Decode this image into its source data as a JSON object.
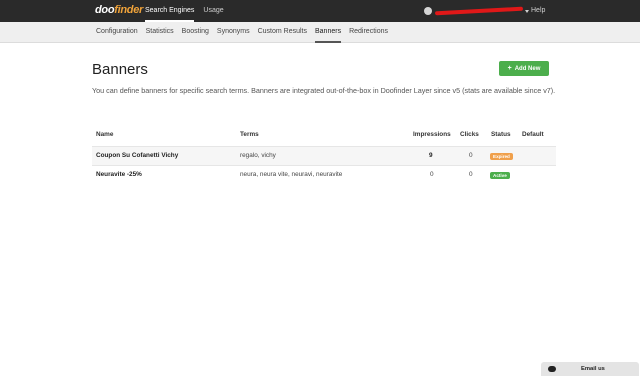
{
  "topbar": {
    "logo_main": "doo",
    "logo_accent": "finder",
    "nav": [
      {
        "label": "Search Engines",
        "active": true
      },
      {
        "label": "Usage",
        "active": false
      }
    ],
    "help": "Help"
  },
  "subnav": {
    "tabs": [
      {
        "label": "Configuration",
        "active": false
      },
      {
        "label": "Statistics",
        "active": false
      },
      {
        "label": "Boosting",
        "active": false
      },
      {
        "label": "Synonyms",
        "active": false
      },
      {
        "label": "Custom Results",
        "active": false
      },
      {
        "label": "Banners",
        "active": true
      },
      {
        "label": "Redirections",
        "active": false
      }
    ]
  },
  "page": {
    "title": "Banners",
    "add_button": "Add New",
    "description": "You can define banners for specific search terms. Banners are integrated out-of-the-box in Doofinder Layer since v5 (stats are available since v7)."
  },
  "table": {
    "headers": {
      "name": "Name",
      "terms": "Terms",
      "impressions": "Impressions",
      "clicks": "Clicks",
      "status": "Status",
      "default": "Default"
    },
    "rows": [
      {
        "name": "Coupon Su Cofanetti Vichy",
        "terms": "regalo, vichy",
        "impressions": "9",
        "clicks": "0",
        "status": "Expired",
        "status_color": "#f0a04b"
      },
      {
        "name": "Neuravite -25%",
        "terms": "neura, neura vite, neuravi, neuravite",
        "impressions": "0",
        "clicks": "0",
        "status": "Active",
        "status_color": "#4cae4c"
      }
    ]
  },
  "chat": {
    "label": "Email us"
  }
}
